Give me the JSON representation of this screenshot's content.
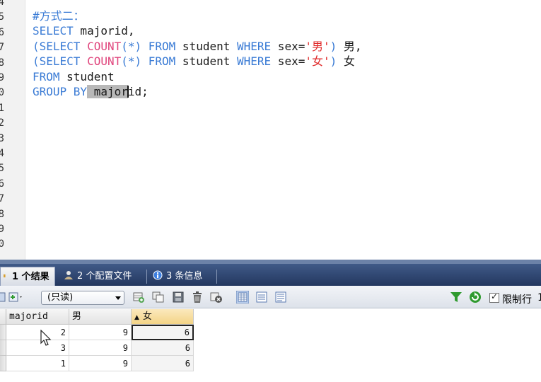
{
  "editor": {
    "line_number_digits": [
      "4",
      "5",
      "6",
      "7",
      "8",
      "9",
      "0",
      "1",
      "2",
      "3",
      "4",
      "5",
      "6",
      "7",
      "8",
      "9",
      "0"
    ],
    "code_lines": [
      [
        {
          "t": "#方式二：",
          "c": "cm"
        }
      ],
      [
        {
          "t": "SELECT",
          "c": "kw"
        },
        {
          "t": " majorid,",
          "c": "tx"
        }
      ],
      [
        {
          "t": "(SELECT ",
          "c": "kw"
        },
        {
          "t": "COUNT",
          "c": "fn"
        },
        {
          "t": "(*) ",
          "c": "kw"
        },
        {
          "t": "FROM",
          "c": "kw"
        },
        {
          "t": " student ",
          "c": "tx"
        },
        {
          "t": "WHERE",
          "c": "kw"
        },
        {
          "t": " sex=",
          "c": "tx"
        },
        {
          "t": "'男'",
          "c": "st"
        },
        {
          "t": ") ",
          "c": "kw"
        },
        {
          "t": "男,",
          "c": "tx"
        }
      ],
      [
        {
          "t": "(SELECT ",
          "c": "kw"
        },
        {
          "t": "COUNT",
          "c": "fn"
        },
        {
          "t": "(*) ",
          "c": "kw"
        },
        {
          "t": "FROM",
          "c": "kw"
        },
        {
          "t": " student ",
          "c": "tx"
        },
        {
          "t": "WHERE",
          "c": "kw"
        },
        {
          "t": " sex=",
          "c": "tx"
        },
        {
          "t": "'女'",
          "c": "st"
        },
        {
          "t": ") ",
          "c": "kw"
        },
        {
          "t": "女",
          "c": "tx"
        }
      ],
      [
        {
          "t": "FROM",
          "c": "kw"
        },
        {
          "t": " student",
          "c": "tx"
        }
      ],
      [
        {
          "t": "GROUP BY",
          "c": "kw"
        },
        {
          "t": " ",
          "c": "sel"
        },
        {
          "t": "major",
          "c": "sel"
        },
        {
          "t": "|",
          "c": "caret"
        },
        {
          "t": "id;",
          "c": "tx"
        }
      ]
    ]
  },
  "tabs": [
    {
      "label": "1 个结果",
      "icon": "results-table-icon",
      "active": true
    },
    {
      "label": "2 个配置文件",
      "icon": "profile-icon",
      "active": false
    },
    {
      "label": "3 条信息",
      "icon": "info-icon",
      "active": false
    }
  ],
  "toolbar": {
    "mode_select_value": "(只读)",
    "limit_rows_label": "限制行",
    "limit_rows_checked": true,
    "limit_rows_value_partial": "1"
  },
  "grid": {
    "columns": [
      "majorid",
      "男",
      "女"
    ],
    "sorted_column": "女",
    "sort_indicator": "▲",
    "rows": [
      [
        "2",
        "9",
        "6"
      ],
      [
        "3",
        "9",
        "6"
      ],
      [
        "1",
        "9",
        "6"
      ]
    ]
  },
  "colors": {
    "keyword": "#3a7bd5",
    "function": "#e0447c",
    "string": "#e02b2b",
    "tab_bar": "#2e4470",
    "filter_icon": "#2f9a2f"
  }
}
